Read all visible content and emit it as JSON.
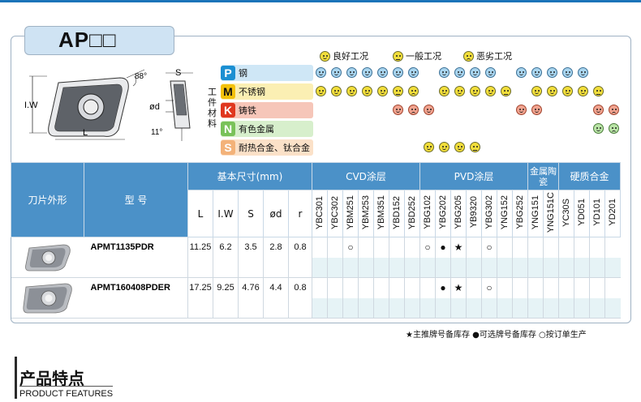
{
  "header": {
    "title": "AP□□"
  },
  "legend": [
    {
      "icon": "good-face-icon",
      "label": "良好工况"
    },
    {
      "icon": "normal-face-icon",
      "label": "一般工况"
    },
    {
      "icon": "bad-face-icon",
      "label": "恶劣工况"
    }
  ],
  "drawing": {
    "angle": "88°",
    "angle2": "11°",
    "dim_s": "S",
    "dim_iw": "I.W",
    "dim_l": "L",
    "dim_d": "ød"
  },
  "materials": {
    "side_label": "工件材料",
    "rows": [
      {
        "letter": "P",
        "name": "钢",
        "color": "#1b8fd2",
        "bar": "#cfe7f6"
      },
      {
        "letter": "M",
        "name": "不锈钢",
        "color": "#f3c10b",
        "bar": "#fbefb3"
      },
      {
        "letter": "K",
        "name": "铸铁",
        "color": "#e0371f",
        "bar": "#f6c6b9"
      },
      {
        "letter": "N",
        "name": "有色金属",
        "color": "#79c25a",
        "bar": "#d7efcc"
      },
      {
        "letter": "S",
        "name": "耐热合金、钛合金",
        "color": "#f3b279",
        "bar": "#fbe1c8"
      }
    ]
  },
  "table": {
    "col_shape": "刀片外形",
    "col_model": "型 号",
    "dims_title": "基本尺寸(mm)",
    "dims": [
      "L",
      "I.W",
      "S",
      "ød",
      "r"
    ],
    "groups": [
      {
        "label": "CVD涂层",
        "grades": [
          "YBC301",
          "YBC302",
          "YBM251",
          "YBM253",
          "YBM351",
          "YBD152",
          "YBD252"
        ]
      },
      {
        "label": "PVD涂层",
        "grades": [
          "YBG102",
          "YBG202",
          "YBG205",
          "YB9320",
          "YBG302",
          "YNG152",
          "YBG252"
        ]
      },
      {
        "label": "金属陶瓷",
        "grades": [
          "YNG151",
          "YNG151C"
        ]
      },
      {
        "label": "硬质合金",
        "grades": [
          "YC30S",
          "YD051",
          "YD101",
          "YD201"
        ]
      }
    ],
    "rows": [
      {
        "model": "APMT1135PDR",
        "L": "11.25",
        "IW": "6.2",
        "S": "3.5",
        "d": "2.8",
        "r": "0.8",
        "marks": {
          "YBM251": "○",
          "YBG102": "○",
          "YBG202": "●",
          "YBG205": "★",
          "YBG302": "○"
        }
      },
      {
        "model": "APMT160408PDER",
        "L": "17.25",
        "IW": "9.25",
        "S": "4.76",
        "d": "4.4",
        "r": "0.8",
        "marks": {
          "YBG202": "●",
          "YBG205": "★",
          "YBG302": "○"
        }
      }
    ]
  },
  "footnote": "★主推牌号备库存 ●可选牌号备库存 ○按订单生产",
  "features": {
    "title": "产品特点",
    "subtitle": "PRODUCT FEATURES"
  }
}
